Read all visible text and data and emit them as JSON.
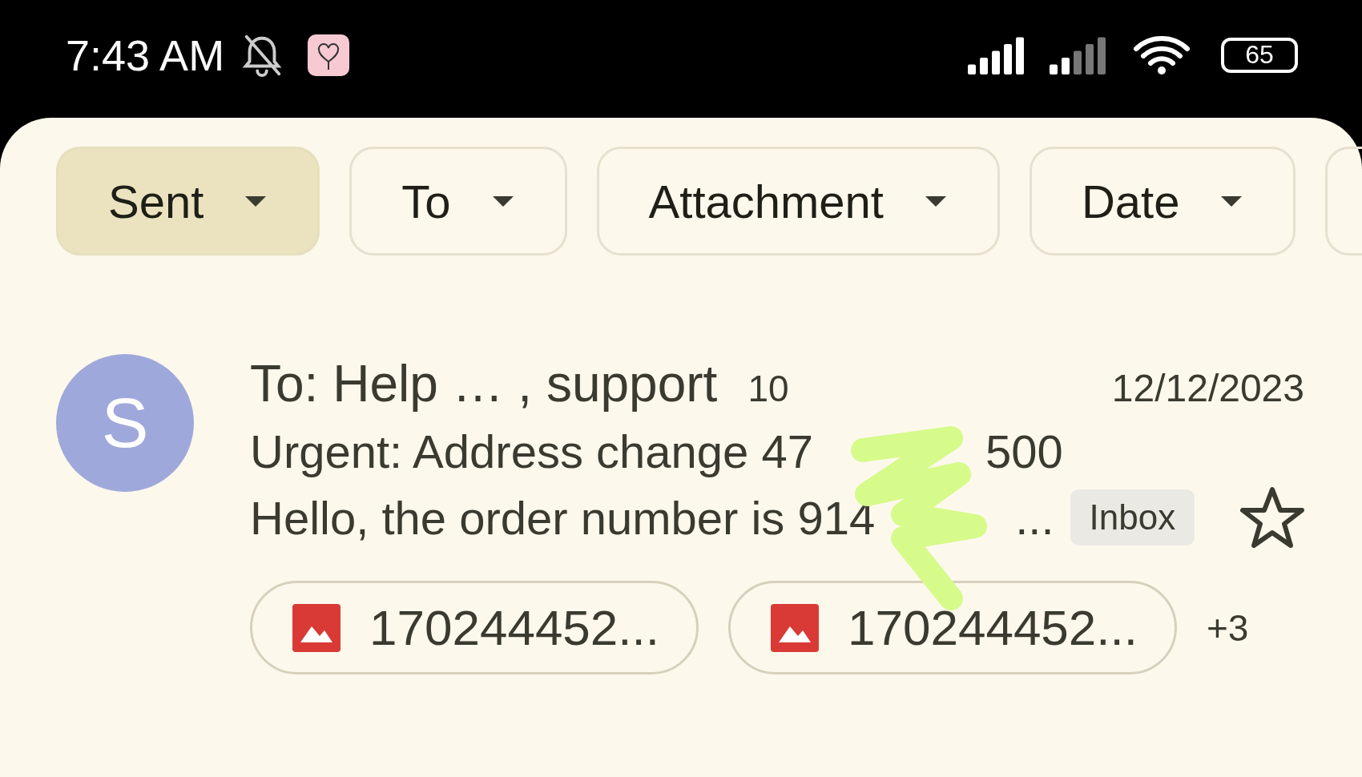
{
  "status_bar": {
    "time": "7:43 AM",
    "battery": "65"
  },
  "filters": [
    {
      "label": "Sent",
      "selected": true
    },
    {
      "label": "To",
      "selected": false
    },
    {
      "label": "Attachment",
      "selected": false
    },
    {
      "label": "Date",
      "selected": false
    }
  ],
  "email": {
    "avatar": "S",
    "recipients": "To: Help … , support",
    "count": "10",
    "date": "12/12/2023",
    "subject_parts": [
      "Urgent: Address change 47",
      "500"
    ],
    "preview_parts": [
      "Hello, the order number is 914",
      "..."
    ],
    "label": "Inbox",
    "starred": false,
    "attachments": [
      {
        "name": "170244452..."
      },
      {
        "name": "170244452..."
      }
    ],
    "more": "+3"
  }
}
